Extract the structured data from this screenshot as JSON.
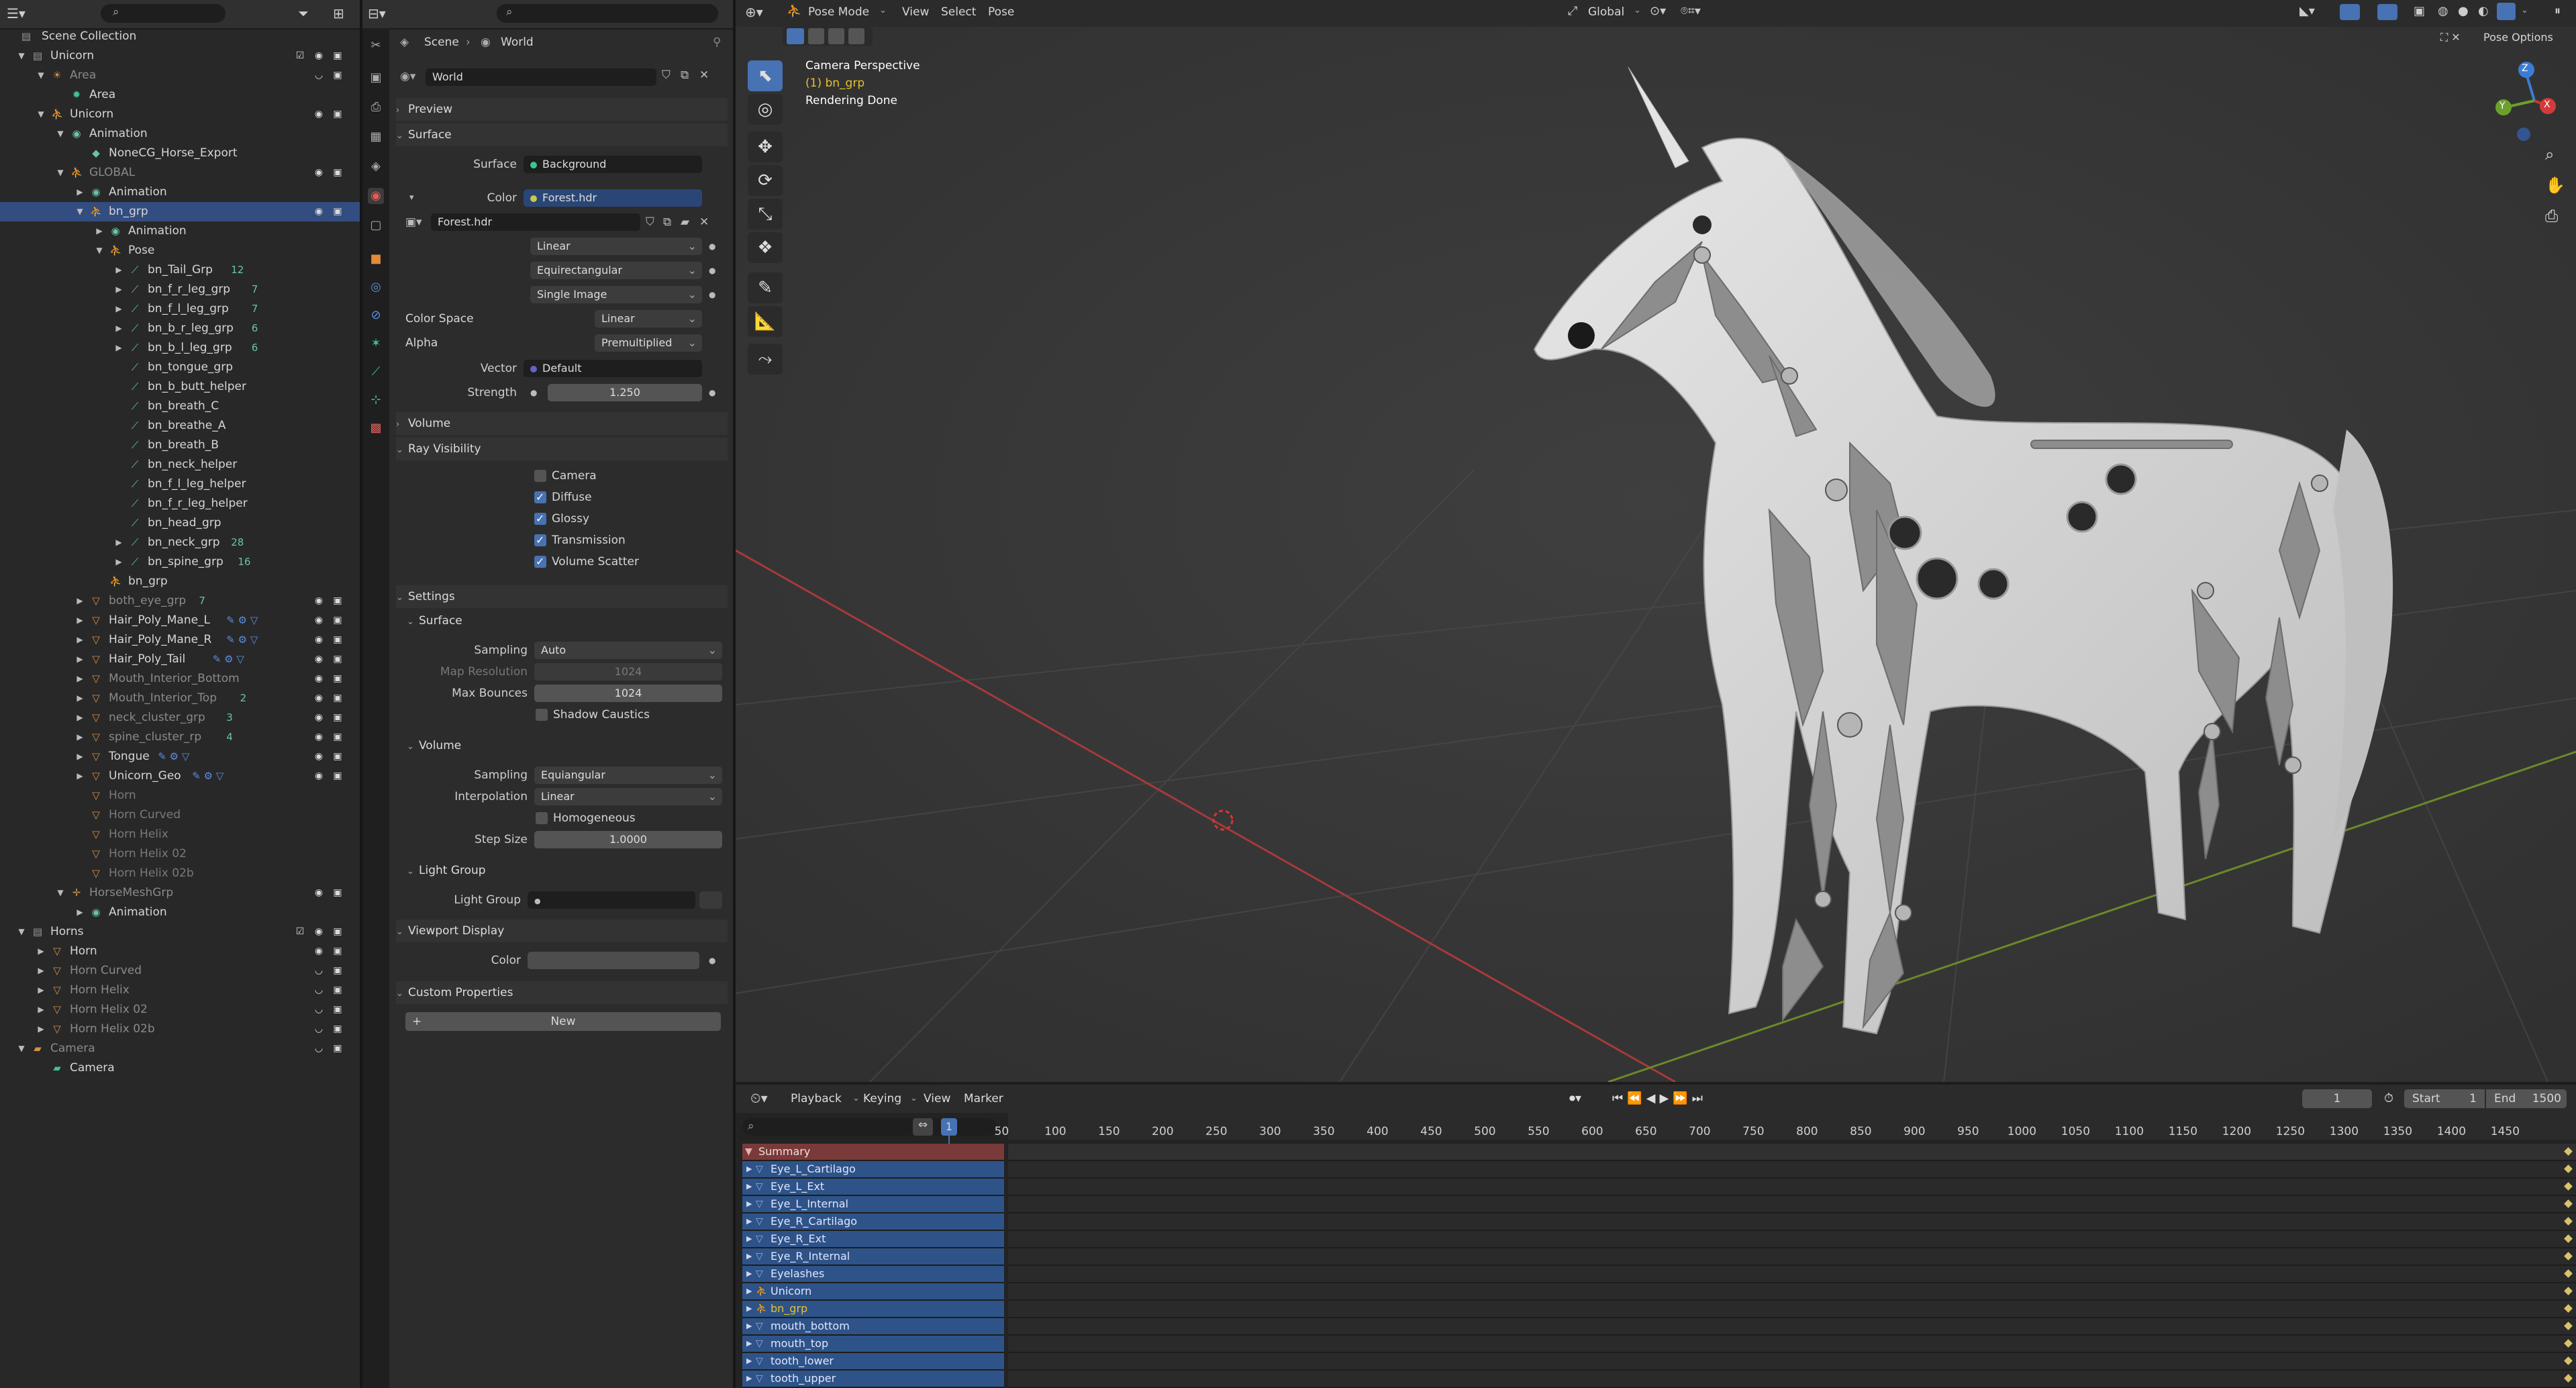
{
  "outliner": {
    "search_placeholder": "",
    "root": "Scene Collection",
    "rows": [
      {
        "label": "Unicorn",
        "indent": 1,
        "icon": "collection-icon",
        "color": "c-grey",
        "exp": "open",
        "vis": true,
        "chk": true
      },
      {
        "label": "Area",
        "indent": 2,
        "icon": "light-icon",
        "color": "c-orange",
        "exp": "open",
        "dim": true,
        "hidden": true
      },
      {
        "label": "Area",
        "indent": 3,
        "icon": "light-data-icon",
        "color": "c-green",
        "exp": ""
      },
      {
        "label": "Unicorn",
        "indent": 2,
        "icon": "armature-icon",
        "color": "c-orange",
        "exp": "open",
        "vis": true
      },
      {
        "label": "Animation",
        "indent": 3,
        "icon": "anim-icon",
        "color": "c-teal",
        "exp": "open"
      },
      {
        "label": "NoneCG_Horse_Export",
        "indent": 4,
        "icon": "action-icon",
        "color": "c-teal",
        "exp": ""
      },
      {
        "label": "GLOBAL",
        "indent": 3,
        "icon": "armature-icon",
        "color": "c-orange",
        "exp": "open",
        "dim": true,
        "vis": true
      },
      {
        "label": "Animation",
        "indent": 4,
        "icon": "anim-icon",
        "color": "c-teal",
        "exp": "closed"
      },
      {
        "label": "bn_grp",
        "indent": 4,
        "icon": "armature-icon",
        "color": "c-orange",
        "exp": "open",
        "sel": true,
        "vis": true
      },
      {
        "label": "Animation",
        "indent": 5,
        "icon": "anim-icon",
        "color": "c-teal",
        "exp": "closed"
      },
      {
        "label": "Pose",
        "indent": 5,
        "icon": "pose-icon",
        "color": "c-teal",
        "exp": "open"
      },
      {
        "label": "bn_Tail_Grp",
        "indent": 6,
        "icon": "bone-icon",
        "color": "c-teal",
        "exp": "closed",
        "sub": "12"
      },
      {
        "label": "bn_f_r_leg_grp",
        "indent": 6,
        "icon": "bone-icon",
        "color": "c-teal",
        "exp": "closed",
        "sub": "7"
      },
      {
        "label": "bn_f_l_leg_grp",
        "indent": 6,
        "icon": "bone-icon",
        "color": "c-teal",
        "exp": "closed",
        "sub": "7"
      },
      {
        "label": "bn_b_r_leg_grp",
        "indent": 6,
        "icon": "bone-icon",
        "color": "c-teal",
        "exp": "closed",
        "sub": "6"
      },
      {
        "label": "bn_b_l_leg_grp",
        "indent": 6,
        "icon": "bone-icon",
        "color": "c-teal",
        "exp": "closed",
        "sub": "6"
      },
      {
        "label": "bn_tongue_grp",
        "indent": 6,
        "icon": "bone-icon",
        "color": "c-teal",
        "exp": ""
      },
      {
        "label": "bn_b_butt_helper",
        "indent": 6,
        "icon": "bone-icon",
        "color": "c-teal",
        "exp": ""
      },
      {
        "label": "bn_breath_C",
        "indent": 6,
        "icon": "bone-icon",
        "color": "c-teal",
        "exp": ""
      },
      {
        "label": "bn_breathe_A",
        "indent": 6,
        "icon": "bone-icon",
        "color": "c-teal",
        "exp": ""
      },
      {
        "label": "bn_breath_B",
        "indent": 6,
        "icon": "bone-icon",
        "color": "c-teal",
        "exp": ""
      },
      {
        "label": "bn_neck_helper",
        "indent": 6,
        "icon": "bone-icon",
        "color": "c-teal",
        "exp": ""
      },
      {
        "label": "bn_f_l_leg_helper",
        "indent": 6,
        "icon": "bone-icon",
        "color": "c-teal",
        "exp": ""
      },
      {
        "label": "bn_f_r_leg_helper",
        "indent": 6,
        "icon": "bone-icon",
        "color": "c-teal",
        "exp": ""
      },
      {
        "label": "bn_head_grp",
        "indent": 6,
        "icon": "bone-icon",
        "color": "c-teal",
        "exp": ""
      },
      {
        "label": "bn_neck_grp",
        "indent": 6,
        "icon": "bone-icon",
        "color": "c-teal",
        "exp": "closed",
        "sub": "28"
      },
      {
        "label": "bn_spine_grp",
        "indent": 6,
        "icon": "bone-icon",
        "color": "c-teal",
        "exp": "closed",
        "sub": "16"
      },
      {
        "label": "bn_grp",
        "indent": 5,
        "icon": "armature-data-icon",
        "color": "c-teal",
        "exp": ""
      },
      {
        "label": "both_eye_grp",
        "indent": 4,
        "icon": "mesh-icon",
        "color": "c-orange",
        "exp": "closed",
        "dim": true,
        "vis": true,
        "sub": "7"
      },
      {
        "label": "Hair_Poly_Mane_L",
        "indent": 4,
        "icon": "mesh-icon",
        "color": "c-orange",
        "exp": "closed",
        "vis": true,
        "mods": true
      },
      {
        "label": "Hair_Poly_Mane_R",
        "indent": 4,
        "icon": "mesh-icon",
        "color": "c-orange",
        "exp": "closed",
        "vis": true,
        "mods": true
      },
      {
        "label": "Hair_Poly_Tail",
        "indent": 4,
        "icon": "mesh-icon",
        "color": "c-orange",
        "exp": "closed",
        "vis": true,
        "mods": true
      },
      {
        "label": "Mouth_Interior_Bottom",
        "indent": 4,
        "icon": "mesh-icon",
        "color": "c-orange",
        "exp": "closed",
        "dim": true,
        "vis": true
      },
      {
        "label": "Mouth_Interior_Top",
        "indent": 4,
        "icon": "mesh-icon",
        "color": "c-orange",
        "exp": "closed",
        "dim": true,
        "vis": true,
        "sub": "2"
      },
      {
        "label": "neck_cluster_grp",
        "indent": 4,
        "icon": "mesh-icon",
        "color": "c-orange",
        "exp": "closed",
        "dim": true,
        "vis": true,
        "sub": "3"
      },
      {
        "label": "spine_cluster_rp",
        "indent": 4,
        "icon": "mesh-icon",
        "color": "c-orange",
        "exp": "closed",
        "dim": true,
        "vis": true,
        "sub": "4"
      },
      {
        "label": "Tongue",
        "indent": 4,
        "icon": "mesh-icon",
        "color": "c-orange",
        "exp": "closed",
        "vis": true,
        "mods": true
      },
      {
        "label": "Unicorn_Geo",
        "indent": 4,
        "icon": "mesh-icon",
        "color": "c-orange",
        "exp": "closed",
        "vis": true,
        "mods": true
      },
      {
        "label": "Horn",
        "indent": 4,
        "icon": "mesh-icon",
        "color": "c-orange",
        "exp": "",
        "grey": true
      },
      {
        "label": "Horn Curved",
        "indent": 4,
        "icon": "mesh-icon",
        "color": "c-orange",
        "exp": "",
        "grey": true
      },
      {
        "label": "Horn Helix",
        "indent": 4,
        "icon": "mesh-icon",
        "color": "c-orange",
        "exp": "",
        "grey": true
      },
      {
        "label": "Horn Helix 02",
        "indent": 4,
        "icon": "mesh-icon",
        "color": "c-orange",
        "exp": "",
        "grey": true
      },
      {
        "label": "Horn Helix 02b",
        "indent": 4,
        "icon": "mesh-icon",
        "color": "c-orange",
        "exp": "",
        "grey": true
      },
      {
        "label": "HorseMeshGrp",
        "indent": 3,
        "icon": "empty-icon",
        "color": "c-orange",
        "exp": "open",
        "dim": true,
        "vis": true
      },
      {
        "label": "Animation",
        "indent": 4,
        "icon": "anim-icon",
        "color": "c-teal",
        "exp": "closed"
      },
      {
        "label": "Horns",
        "indent": 1,
        "icon": "collection-icon",
        "color": "c-grey",
        "exp": "open",
        "vis": true,
        "chk": true
      },
      {
        "label": "Horn",
        "indent": 2,
        "icon": "mesh-icon",
        "color": "c-orange",
        "exp": "closed",
        "vis": true
      },
      {
        "label": "Horn Curved",
        "indent": 2,
        "icon": "mesh-icon",
        "color": "c-orange",
        "exp": "closed",
        "dim": true,
        "hidden": true
      },
      {
        "label": "Horn Helix",
        "indent": 2,
        "icon": "mesh-icon",
        "color": "c-orange",
        "exp": "closed",
        "dim": true,
        "hidden": true
      },
      {
        "label": "Horn Helix 02",
        "indent": 2,
        "icon": "mesh-icon",
        "color": "c-orange",
        "exp": "closed",
        "dim": true,
        "hidden": true
      },
      {
        "label": "Horn Helix 02b",
        "indent": 2,
        "icon": "mesh-icon",
        "color": "c-orange",
        "exp": "closed",
        "dim": true,
        "hidden": true
      },
      {
        "label": "Camera",
        "indent": 1,
        "icon": "camera-obj-icon",
        "color": "c-orange",
        "exp": "open",
        "dim": true,
        "hidden": true
      },
      {
        "label": "Camera",
        "indent": 2,
        "icon": "camera-data-icon",
        "color": "c-green",
        "exp": ""
      }
    ]
  },
  "properties": {
    "breadcrumb_scene": "Scene",
    "breadcrumb_sep": "›",
    "breadcrumb_world": "World",
    "world_name": "World",
    "sections": {
      "preview": "Preview",
      "surface": "Surface",
      "volume": "Volume",
      "ray_visibility": "Ray Visibility",
      "settings": "Settings",
      "settings_surface": "Surface",
      "settings_volume": "Volume",
      "light_group": "Light Group",
      "viewport_display": "Viewport Display",
      "custom_properties": "Custom Properties"
    },
    "surface_label": "Surface",
    "surface_value": "Background",
    "color_label": "Color",
    "color_value": "Forest.hdr",
    "image_name": "Forest.hdr",
    "interpolation": "Linear",
    "projection": "Equirectangular",
    "source": "Single Image",
    "color_space_label": "Color Space",
    "color_space": "Linear",
    "alpha_label": "Alpha",
    "alpha": "Premultiplied",
    "vector_label": "Vector",
    "vector": "Default",
    "strength_label": "Strength",
    "strength": "1.250",
    "ray": [
      {
        "label": "Camera",
        "on": false
      },
      {
        "label": "Diffuse",
        "on": true
      },
      {
        "label": "Glossy",
        "on": true
      },
      {
        "label": "Transmission",
        "on": true
      },
      {
        "label": "Volume Scatter",
        "on": true
      }
    ],
    "sampling_label": "Sampling",
    "sampling": "Auto",
    "map_res_label": "Map Resolution",
    "map_res": "1024",
    "max_bounces_label": "Max Bounces",
    "max_bounces": "1024",
    "shadow_caustics": "Shadow Caustics",
    "vol_sampling_label": "Sampling",
    "vol_sampling": "Equiangular",
    "vol_interp_label": "Interpolation",
    "vol_interp": "Linear",
    "homogeneous": "Homogeneous",
    "step_size_label": "Step Size",
    "step_size": "1.0000",
    "light_group_label": "Light Group",
    "vd_color_label": "Color",
    "new_button": "New",
    "plus": "+"
  },
  "viewport": {
    "mode": "Pose Mode",
    "menus": [
      "View",
      "Select",
      "Pose"
    ],
    "orientation": "Global",
    "options": "Pose Options",
    "overlay_title": "Camera Perspective",
    "overlay_obj": "(1) bn_grp",
    "overlay_status": "Rendering Done",
    "gizmo_z": "Z",
    "gizmo_x": "X",
    "gizmo_y": "Y"
  },
  "timeline": {
    "menus": [
      "Playback",
      "Keying",
      "View",
      "Marker"
    ],
    "current_frame": "1",
    "start_label": "Start",
    "start": "1",
    "end_label": "End",
    "end": "1500",
    "ticks": [
      "50",
      "100",
      "150",
      "200",
      "250",
      "300",
      "350",
      "400",
      "450",
      "500",
      "550",
      "600",
      "650",
      "700",
      "750",
      "800",
      "850",
      "900",
      "950",
      "1000",
      "1050",
      "1100",
      "1150",
      "1200",
      "1250",
      "1300",
      "1350",
      "1400",
      "1450"
    ],
    "cursor_frame": "1",
    "channels": [
      {
        "name": "Summary",
        "icon": "summary",
        "sum": true
      },
      {
        "name": "Eye_L_Cartilago",
        "icon": "mesh"
      },
      {
        "name": "Eye_L_Ext",
        "icon": "mesh"
      },
      {
        "name": "Eye_L_Internal",
        "icon": "mesh"
      },
      {
        "name": "Eye_R_Cartilago",
        "icon": "mesh"
      },
      {
        "name": "Eye_R_Ext",
        "icon": "mesh"
      },
      {
        "name": "Eye_R_Internal",
        "icon": "mesh"
      },
      {
        "name": "Eyelashes",
        "icon": "mesh"
      },
      {
        "name": "Unicorn",
        "icon": "armature"
      },
      {
        "name": "bn_grp",
        "icon": "armature",
        "active": true
      },
      {
        "name": "mouth_bottom",
        "icon": "mesh"
      },
      {
        "name": "mouth_top",
        "icon": "mesh"
      },
      {
        "name": "tooth_lower",
        "icon": "mesh"
      },
      {
        "name": "tooth_upper",
        "icon": "mesh"
      }
    ]
  }
}
